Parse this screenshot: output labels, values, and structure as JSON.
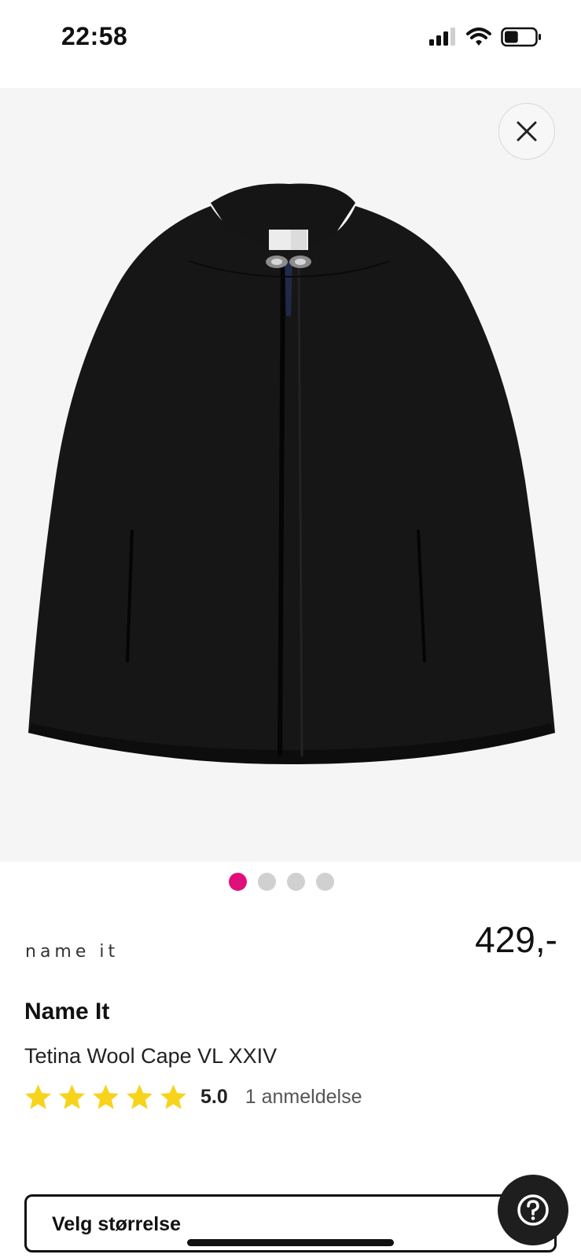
{
  "status_bar": {
    "time": "22:58",
    "battery_level": 0.45
  },
  "gallery": {
    "image_icon": "black-wool-cape-image",
    "slide_count": 4,
    "active_slide": 1,
    "active_color": "#e0107a"
  },
  "product": {
    "brand_logo": "name it",
    "brand": "Name It",
    "name": "Tetina Wool Cape VL XXIV",
    "price": "429,-",
    "rating": "5.0",
    "rating_stars": 5,
    "star_color": "#f8d31c",
    "reviews": "1 anmeldelse"
  },
  "size_selector": {
    "label": "Velg størrelse"
  },
  "help_icon": "question-mark-icon"
}
